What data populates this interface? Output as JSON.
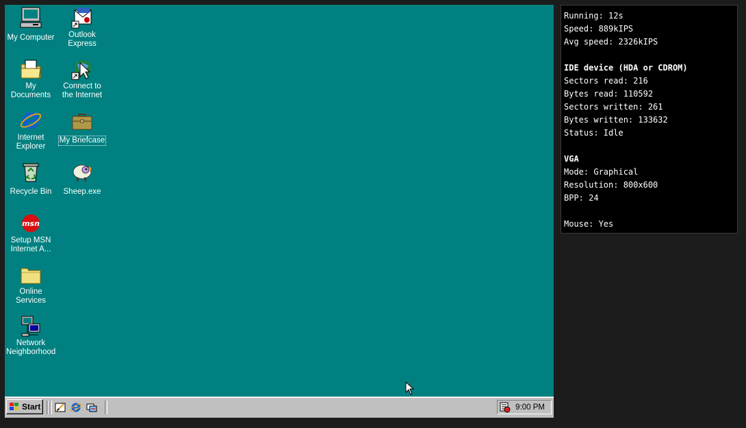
{
  "desktop": {
    "icons": [
      {
        "label": "My Computer",
        "name": "my-computer-icon"
      },
      {
        "label": "Outlook Express",
        "name": "outlook-express-icon"
      },
      {
        "label": "My Documents",
        "name": "my-documents-icon"
      },
      {
        "label": "Connect to the Internet",
        "name": "connect-internet-icon"
      },
      {
        "label": "Internet Explorer",
        "name": "internet-explorer-icon"
      },
      {
        "label": "My Briefcase",
        "name": "briefcase-icon"
      },
      {
        "label": "Recycle Bin",
        "name": "recycle-bin-icon"
      },
      {
        "label": "Sheep.exe",
        "name": "sheep-icon"
      },
      {
        "label": "Setup MSN Internet A...",
        "name": "msn-icon"
      },
      {
        "label": "Online Services",
        "name": "folder-icon"
      },
      {
        "label": "Network Neighborhood",
        "name": "network-icon"
      }
    ],
    "background_color": "#008080"
  },
  "taskbar": {
    "start_label": "Start",
    "clock": "9:00 PM",
    "quick_launch": [
      "show-desktop-icon",
      "internet-explorer-icon",
      "channels-icon"
    ]
  },
  "stats": {
    "running": "Running: 12s",
    "speed": "Speed: 889kIPS",
    "avg_speed": "Avg speed: 2326kIPS",
    "ide_header": "IDE device (HDA or CDROM)",
    "sectors_read": "Sectors read: 216",
    "bytes_read": "Bytes read: 110592",
    "sectors_written": "Sectors written: 261",
    "bytes_written": "Bytes written: 133632",
    "status": "Status: Idle",
    "vga_header": "VGA",
    "mode": "Mode: Graphical",
    "resolution": "Resolution: 800x600",
    "bpp": "BPP: 24",
    "mouse": "Mouse: Yes"
  }
}
